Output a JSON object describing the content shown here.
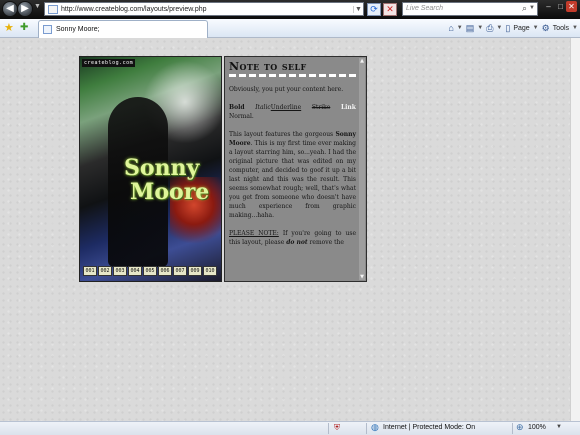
{
  "browser": {
    "address_url": "http://www.createblog.com/layouts/preview.php",
    "search_placeholder": "Live Search",
    "tab_title": "Sonny Moore;",
    "commands": {
      "page": "Page",
      "tools": "Tools"
    }
  },
  "layout_preview": {
    "photo": {
      "brand": "createblog.com",
      "word1": "Sonny",
      "word2": "Moore",
      "numbers": [
        "001",
        "002",
        "003",
        "004",
        "005",
        "006",
        "007",
        "009",
        "010"
      ]
    },
    "note": {
      "title": "Note to self",
      "intro": "Obviously, you put your content here.",
      "format": {
        "bold": "Bold",
        "italic": "Italic",
        "underline": "Underline",
        "strike": "Strike",
        "link": "Link",
        "normal": "Normal."
      },
      "para_lead": "This layout features the gorgeous ",
      "para_name": "Sonny Moore",
      "para_rest": ". This is my first time ever making a layout starring him, so...yeah. I had the original picture that was edited on my computer, and decided to goof it up a bit last night and this was the result. This seems somewhat rough; well, that's what you get from someone who doesn't have much experience from graphic making...haha.",
      "notice_label": "PLEASE NOTE:",
      "notice_text": " If you're going to use this layout, please ",
      "notice_em": "do not",
      "notice_tail": " remove the"
    }
  },
  "status": {
    "zone": "Internet | Protected Mode: On",
    "zoom": "100%"
  },
  "colors": {
    "accent_text": "#dff59a",
    "note_bg": "#8a8a8a",
    "status_shield": "#b02020"
  }
}
